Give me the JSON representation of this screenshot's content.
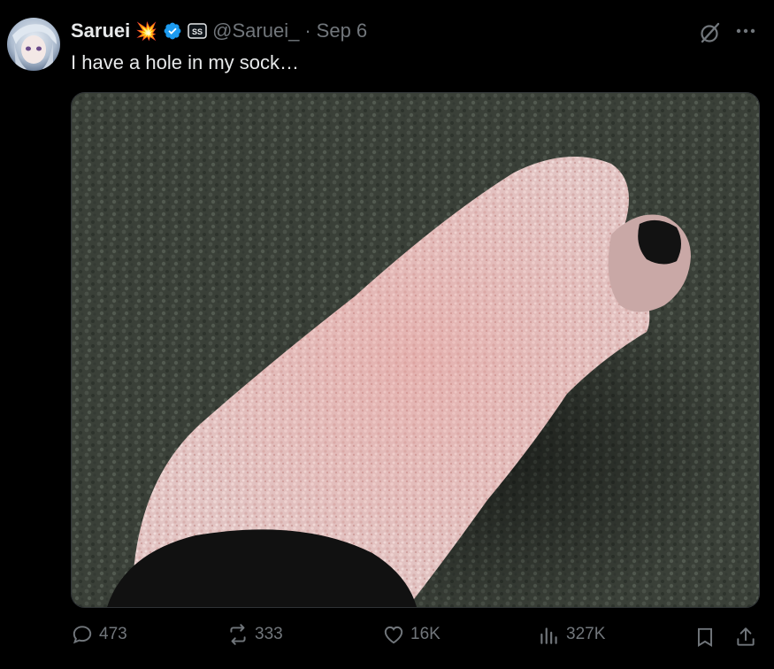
{
  "tweet": {
    "author_name": "Saruei",
    "handle": "@Saruei_",
    "separator": "·",
    "date": "Sep 6",
    "text": "I have a hole in my sock…",
    "badge_emoji": "💥"
  },
  "metrics": {
    "replies": "473",
    "reposts": "333",
    "likes": "16K",
    "views": "327K"
  },
  "colors": {
    "background": "#000000",
    "text": "#e7e9ea",
    "muted": "#71767b",
    "verified": "#1d9bf0"
  },
  "icons": [
    "grok-icon",
    "more-icon",
    "reply-icon",
    "repost-icon",
    "like-icon",
    "views-icon",
    "bookmark-icon",
    "share-icon",
    "verified-badge-icon",
    "affiliate-badge-icon"
  ]
}
